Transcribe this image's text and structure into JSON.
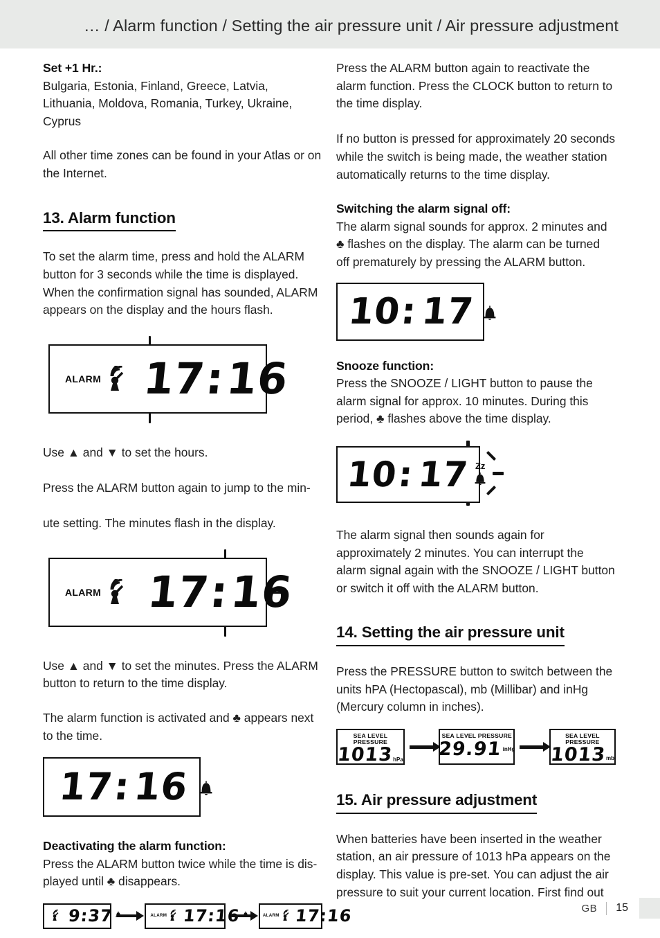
{
  "header": {
    "title": "… / Alarm function / Setting the air pressure unit / Air pressure adjustment"
  },
  "left_column": {
    "set_plus_one_heading": "Set +1 Hr.:",
    "countries": "Bulgaria, Estonia, Finland, Greece, Latvia, Lithuania, Moldova, Romania, Turkey, Ukraine, Cyprus",
    "atlas_note": "All other time zones can be found in your Atlas or on the Internet.",
    "section_13_title": "13. Alarm function",
    "alarm_intro": "To set the alarm time, press and hold the ALARM button for 3 seconds while the time is displayed. When the confirmation signal has sounded, ALARM appears on the display and the hours flash.",
    "fig_hours_flash": {
      "label": "ALARM",
      "icon": "radio-tower-icon",
      "time": "17:16",
      "hours": "17",
      "minutes": "16",
      "flashing": "hours"
    },
    "set_hours_text": "Use ▲ and ▼ to set the hours.\nPress the ALARM button again to jump to the min- ute setting. The minutes flash in the display.",
    "set_hours_line1": "Use ▲ and ▼ to set the hours.",
    "set_hours_line2": "Press the ALARM button again to jump to the min-",
    "set_hours_line3": "ute setting. The minutes flash in the display.",
    "fig_minutes_flash": {
      "label": "ALARM",
      "icon": "radio-tower-icon",
      "time": "17:16",
      "hours": "17",
      "minutes": "16",
      "flashing": "minutes"
    },
    "set_minutes_text": "Use ▲ and ▼ to set the minutes. Press the ALARM button to return to the time display.",
    "alarm_active_text": "The alarm function is activated and ♣ appears next to the time.",
    "fig_time_with_bell": {
      "time": "17:16",
      "hours": "17",
      "minutes": "16",
      "icon": "bell-icon"
    },
    "deactivate_heading": "Deactivating the alarm function:",
    "deactivate_text": "Press the ALARM button twice while the time is dis- played until ♣ disappears.",
    "fig_sequence": [
      {
        "label": "",
        "icon": "radio-tower-icon",
        "time": "9:37",
        "bell": true
      },
      {
        "label": "ALARM",
        "icon": "radio-tower-icon",
        "time": "17:16",
        "bell": true
      },
      {
        "label": "ALARM",
        "icon": "radio-tower-icon",
        "time": "17:16",
        "bell": false
      }
    ],
    "arrow_glyph": "→"
  },
  "right_column": {
    "reactivate_text": "Press the ALARM button again to reactivate the alarm function. Press the CLOCK button to return to the time display.",
    "no_button_text": "If no button is pressed for approximately 20 seconds while the switch is being made, the weather station automatically returns to the time display.",
    "switch_off_heading": "Switching the alarm signal off:",
    "switch_off_text": "The alarm signal sounds for approx. 2 minutes and ♣ flashes on the display. The alarm can be turned off prematurely by pressing the ALARM button.",
    "fig_alarm_sounding": {
      "time": "10:17",
      "hours": "10",
      "minutes": "17",
      "icon": "bell-icon"
    },
    "snooze_heading": "Snooze function:",
    "snooze_text": "Press the SNOOZE / LIGHT button to pause the alarm signal for approx. 10 minutes. During this period, ♣ flashes above the time display.",
    "fig_snooze": {
      "time": "10:17",
      "hours": "10",
      "minutes": "17",
      "icon": "snooze-bell-icon",
      "zz": "Zz",
      "flashing": "bell"
    },
    "snooze_after_text": "The alarm signal then sounds again for approximately 2 minutes. You can interrupt the alarm signal again with the SNOOZE / LIGHT button or switch it off with the ALARM button.",
    "section_14_title": "14. Setting the air pressure unit",
    "pressure_unit_text": "Press the PRESSURE button to switch between the units hPA (Hectopascal), mb (Millibar) and inHg (Mercury column in inches).",
    "fig_pressure_sequence": [
      {
        "label": "SEA LEVEL PRESSURE",
        "value": "1013",
        "unit": "hPa"
      },
      {
        "label": "SEA LEVEL PRESSURE",
        "value": "29.91",
        "unit": "inHg"
      },
      {
        "label": "SEA LEVEL PRESSURE",
        "value": "1013",
        "unit": "mb"
      }
    ],
    "section_15_title": "15. Air pressure adjustment",
    "adjust_text": "When batteries have been inserted in the weather station, an air pressure of 1013 hPa appears on the display. This value is pre-set. You can adjust the air pressure to suit your current location. First find out"
  },
  "footer": {
    "locale": "GB",
    "page": "15"
  },
  "colors": {
    "band": "#e8eae8",
    "ink": "#111111",
    "body_text": "#222222"
  }
}
